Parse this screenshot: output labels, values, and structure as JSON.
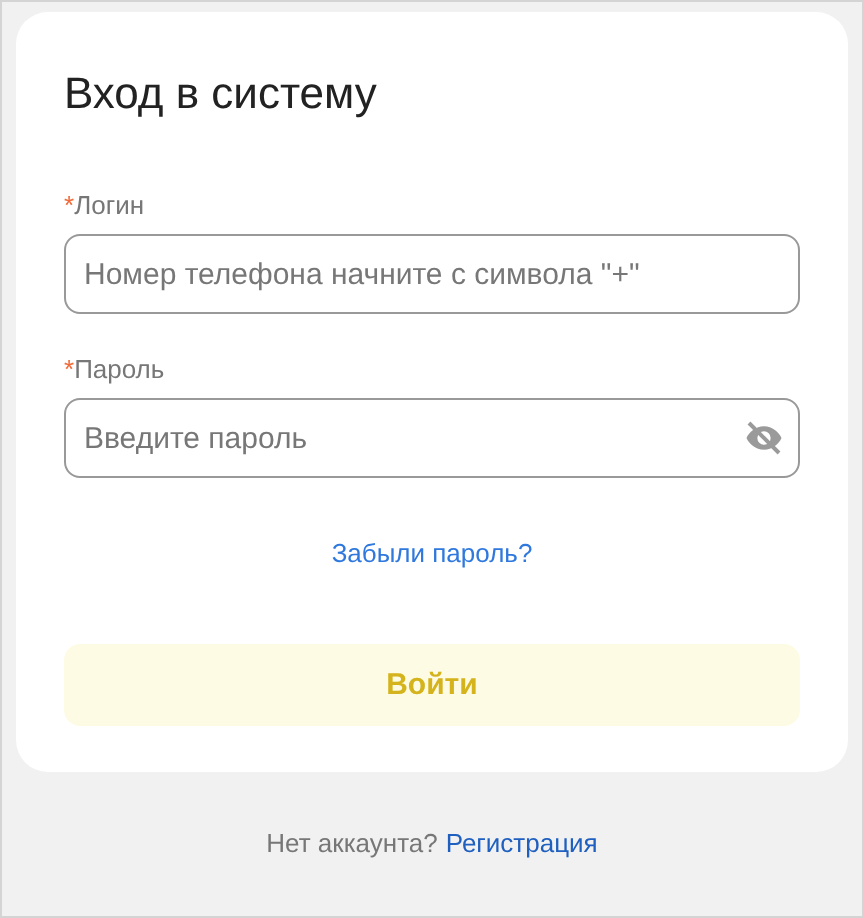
{
  "title": "Вход в систему",
  "fields": [
    {
      "kind": "text",
      "label": "Логин",
      "required": true,
      "required_mark": "*",
      "placeholder": "Номер телефона начните с символа \"+\""
    },
    {
      "kind": "password",
      "label": "Пароль",
      "required": true,
      "required_mark": "*",
      "placeholder": "Введите пароль",
      "visible": false
    }
  ],
  "forgot_link": "Забыли пароль?",
  "submit_button": {
    "label": "Войти",
    "disabled": true
  },
  "footer": {
    "text": "Нет аккаунта?",
    "link": "Регистрация"
  }
}
